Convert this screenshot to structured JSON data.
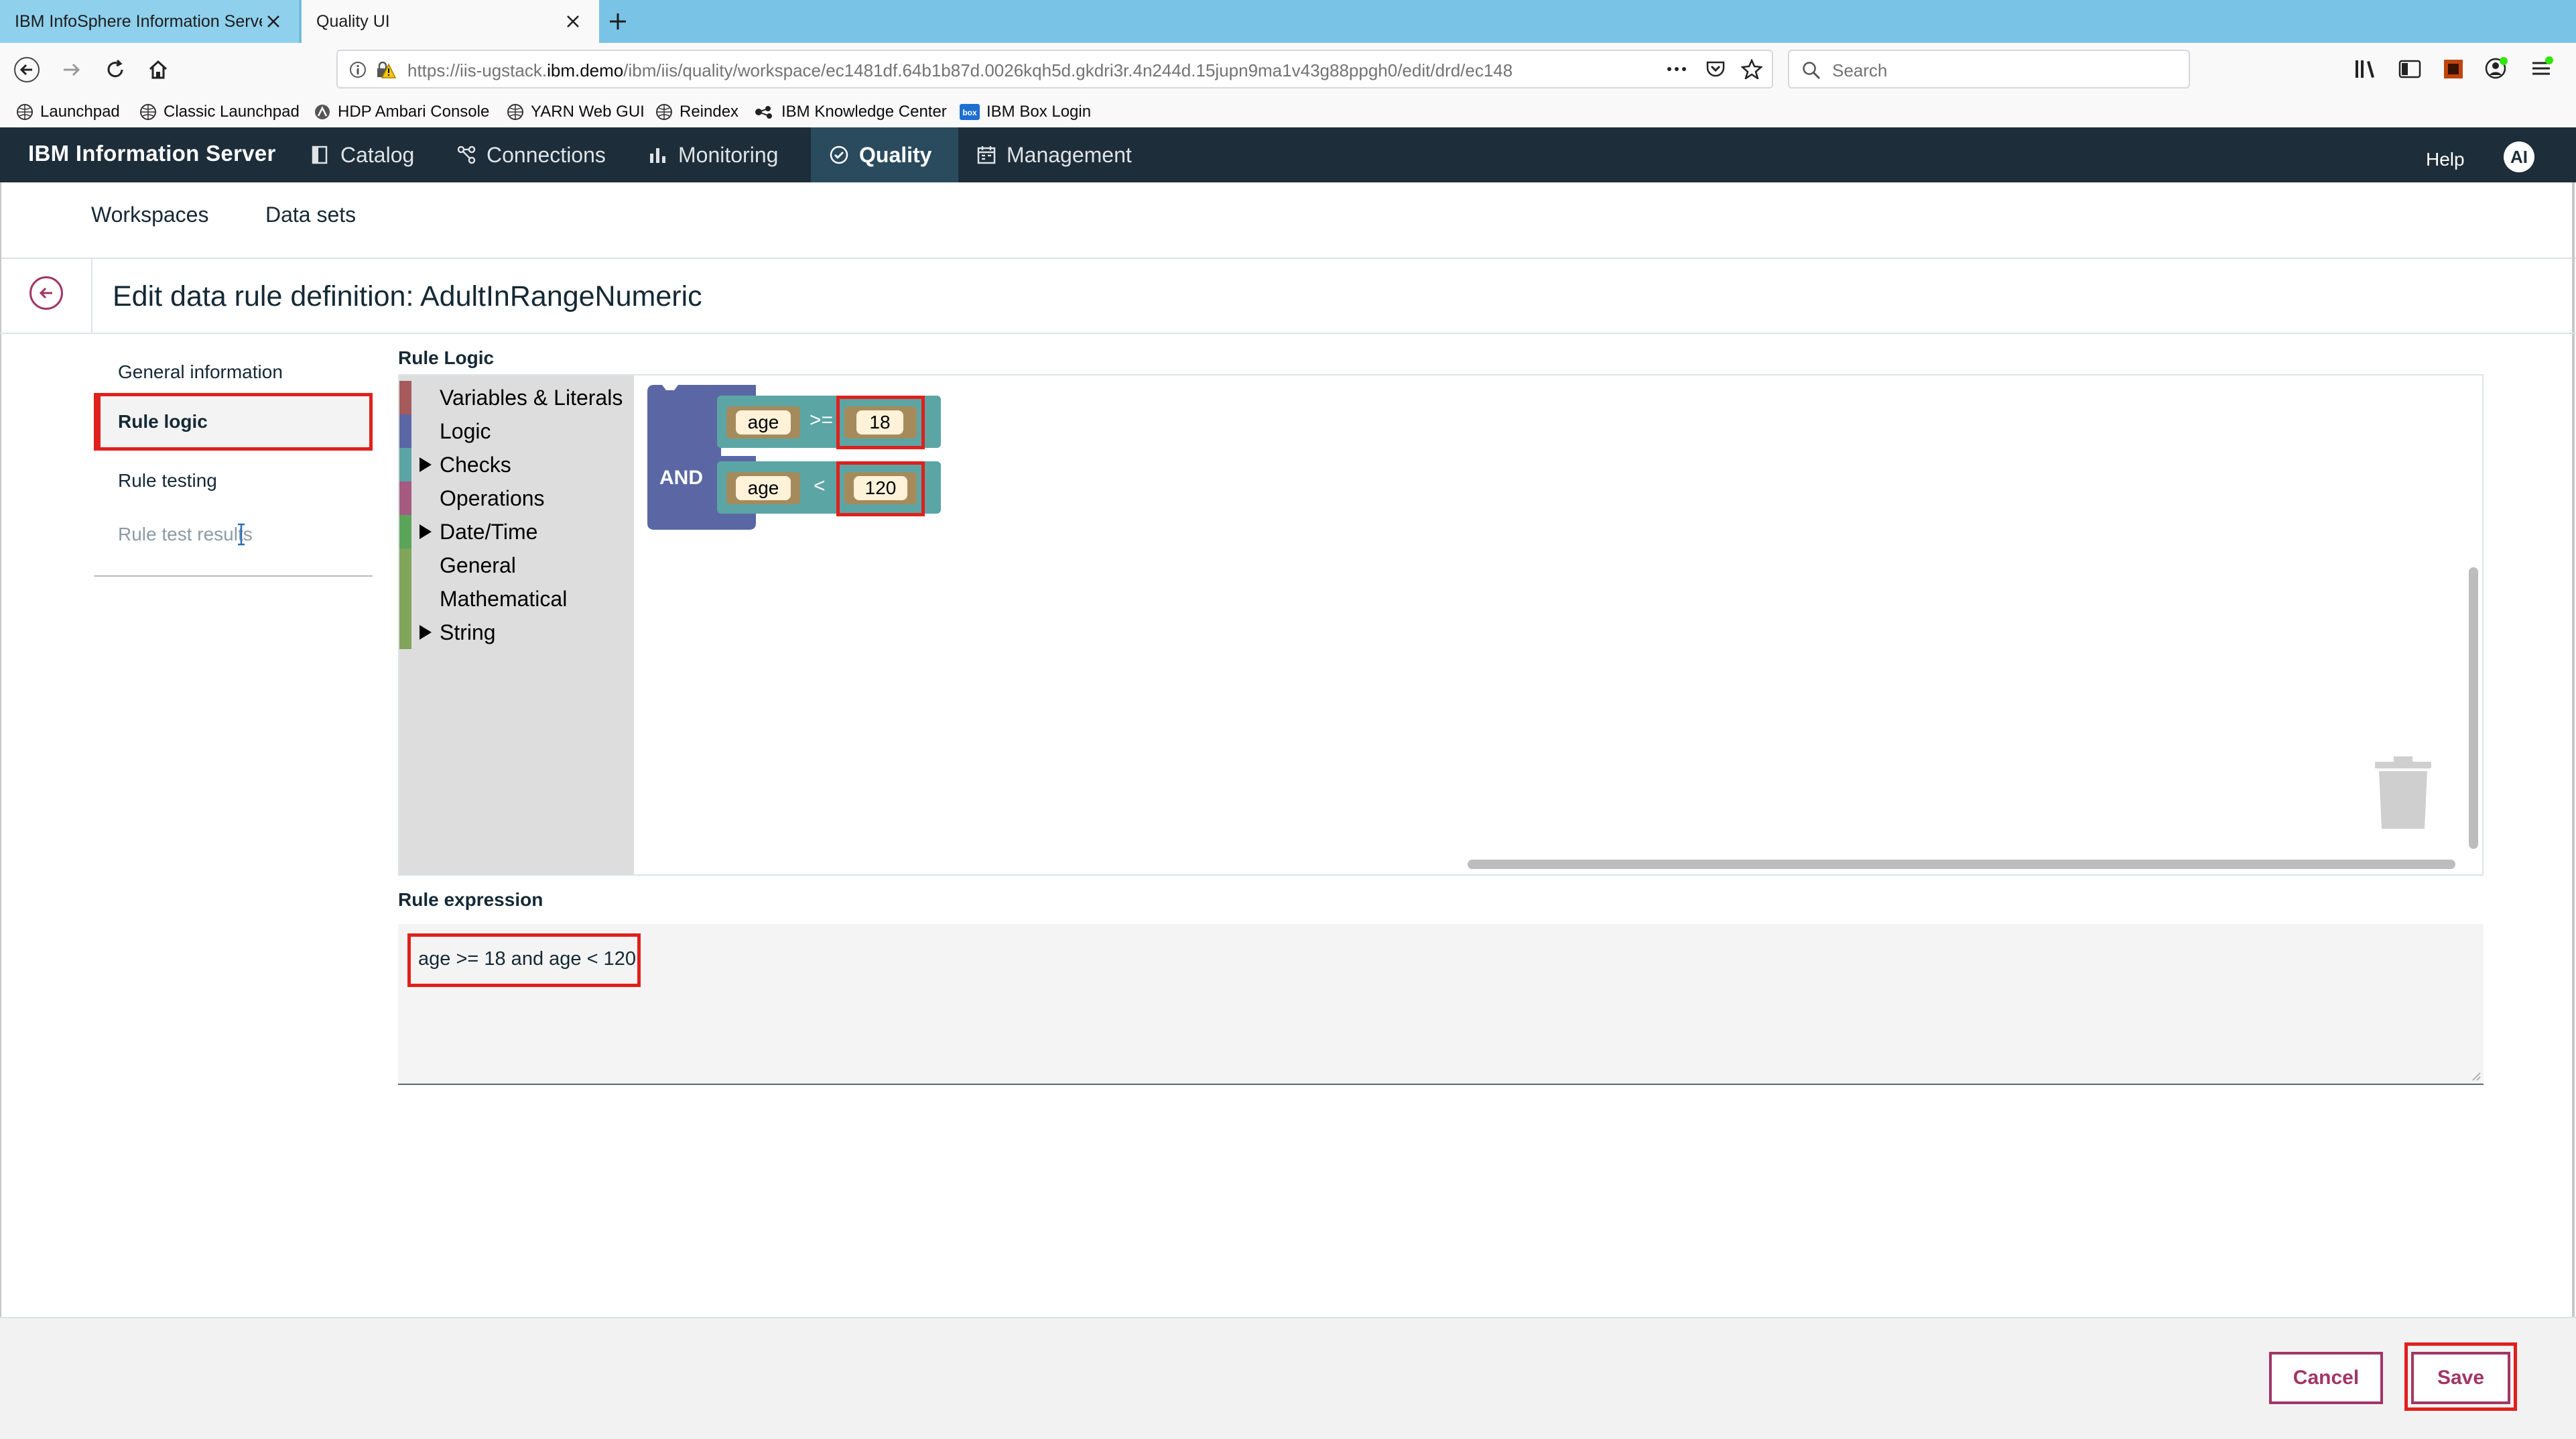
{
  "browser": {
    "tabs": [
      {
        "title": "IBM InfoSphere Information Server",
        "active": false
      },
      {
        "title": "Quality UI",
        "active": true
      }
    ],
    "url": {
      "prefix": "https://iis-ugstack.",
      "host": "ibm.demo",
      "path": "/ibm/iis/quality/workspace/ec1481df.64b1b87d.0026kqh5d.gkdri3r.4n244d.15jupn9ma1v43g88ppgh0/edit/drd/ec148"
    },
    "search_placeholder": "Search",
    "bookmarks": [
      "Launchpad",
      "Classic Launchpad",
      "HDP Ambari Console",
      "YARN Web GUI",
      "Reindex",
      "IBM Knowledge Center",
      "IBM Box Login"
    ]
  },
  "app": {
    "brand": "IBM Information Server",
    "nav": [
      {
        "label": "Catalog",
        "icon": "catalog-icon"
      },
      {
        "label": "Connections",
        "icon": "connections-icon"
      },
      {
        "label": "Monitoring",
        "icon": "monitoring-icon"
      },
      {
        "label": "Quality",
        "icon": "quality-check-icon",
        "active": true
      },
      {
        "label": "Management",
        "icon": "management-icon"
      }
    ],
    "help": "Help",
    "avatar_initials": "AI",
    "brand_color": "#1d2d3a",
    "accent_color": "#a13665"
  },
  "subnav": {
    "workspaces": "Workspaces",
    "datasets": "Data sets"
  },
  "page": {
    "title": "Edit data rule definition: AdultInRangeNumeric"
  },
  "leftnav": [
    {
      "label": "General information",
      "selected": false
    },
    {
      "label": "Rule logic",
      "selected": true
    },
    {
      "label": "Rule testing",
      "selected": false
    },
    {
      "label": "Rule test results",
      "selected": false
    }
  ],
  "rule_logic": {
    "label": "Rule Logic",
    "categories": [
      {
        "label": "Variables & Literals",
        "color": "#a55b5b",
        "expandable": false
      },
      {
        "label": "Logic",
        "color": "#5b67a5",
        "expandable": false
      },
      {
        "label": "Checks",
        "color": "#5ba5a5",
        "expandable": true
      },
      {
        "label": "Operations",
        "color": "#a55b80",
        "expandable": false
      },
      {
        "label": "Date/Time",
        "color": "#5ba55b",
        "expandable": true
      },
      {
        "label": "General",
        "color": "#80a55b",
        "expandable": false
      },
      {
        "label": "Mathematical",
        "color": "#80a55b",
        "expandable": false
      },
      {
        "label": "String",
        "color": "#80a55b",
        "expandable": true
      }
    ],
    "block": {
      "operator": "AND",
      "conditions": [
        {
          "variable": "age",
          "op": ">=",
          "value": "18"
        },
        {
          "variable": "age",
          "op": "<",
          "value": "120"
        }
      ]
    }
  },
  "rule_expression": {
    "label": "Rule expression",
    "value": "age >= 18 and age < 120"
  },
  "footer": {
    "cancel": "Cancel",
    "save": "Save"
  }
}
